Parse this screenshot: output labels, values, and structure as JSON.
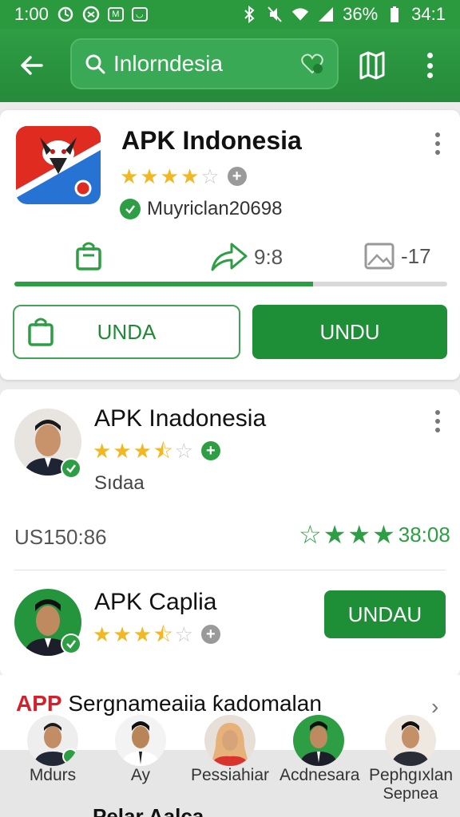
{
  "status_bar": {
    "time": "1:00",
    "battery_percent": "36%",
    "clock_right": "34:1"
  },
  "app_bar": {
    "search_text": "Inlorndesia"
  },
  "card1": {
    "title": "APK Indonesia",
    "rating": 4,
    "developer": "Muyriclan20698",
    "stat_share": "9:8",
    "stat_images": "-17",
    "progress_fraction": 0.69,
    "btn_outline_label": "UNDA",
    "btn_solid_label": "UNDU"
  },
  "card2": {
    "item1": {
      "title": "APK Inadonesia",
      "rating": 3.5,
      "subtitle": "Sıdaa"
    },
    "left_value": "US150:86",
    "right_value": "38:08",
    "item2": {
      "title": "APK Caplia",
      "rating": 3.5,
      "button_label": "UNDAU"
    }
  },
  "section3": {
    "title_prefix": "APP",
    "title_rest": "Sergnameaiia ƙadomalan",
    "people": [
      {
        "name": "Mdurs",
        "sub": ""
      },
      {
        "name": "Ay",
        "sub": ""
      },
      {
        "name": "Pessiahiar",
        "sub": ""
      },
      {
        "name": "Acdnesara",
        "sub": ""
      },
      {
        "name": "Pephgıxlan",
        "sub": "Sepnea"
      }
    ],
    "peek_text": "Pelar Aalca"
  },
  "colors": {
    "primary_green": "#2e9e44",
    "star_gold": "#f2b824",
    "accent_red": "#d4202a"
  }
}
